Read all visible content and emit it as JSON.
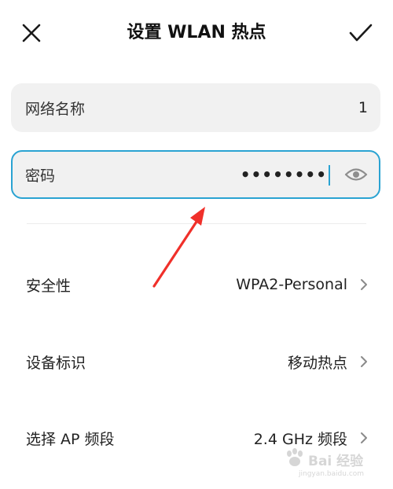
{
  "header": {
    "title": "设置 WLAN 热点",
    "close_icon": "close-icon",
    "confirm_icon": "checkmark-icon"
  },
  "network_name": {
    "label": "网络名称",
    "value": "1"
  },
  "password": {
    "label": "密码",
    "masked_value": "••••••••",
    "visibility_icon": "eye-icon",
    "focus_color": "#2aa3d2"
  },
  "settings": {
    "security": {
      "label": "安全性",
      "value": "WPA2-Personal"
    },
    "device_id": {
      "label": "设备标识",
      "value": "移动热点"
    },
    "ap_band": {
      "label": "选择 AP 频段",
      "value": "2.4 GHz 频段"
    }
  },
  "annotation": {
    "arrow_color": "#f0302a"
  },
  "watermark": {
    "text": "Bai 经验",
    "url": "jingyan.baidu.com"
  }
}
